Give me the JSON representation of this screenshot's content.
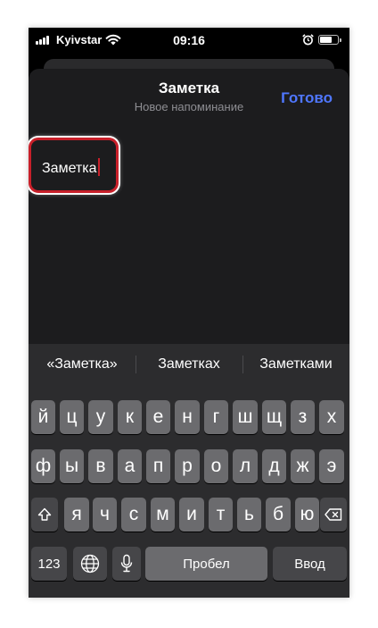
{
  "status": {
    "carrier": "Kyivstar",
    "time": "09:16"
  },
  "nav": {
    "title": "Заметка",
    "subtitle": "Новое напоминание",
    "done": "Готово"
  },
  "note": {
    "value": "Заметка"
  },
  "suggestions": [
    "«Заметка»",
    "Заметках",
    "Заметками"
  ],
  "keyboard": {
    "row1": [
      "й",
      "ц",
      "у",
      "к",
      "е",
      "н",
      "г",
      "ш",
      "щ",
      "з",
      "х"
    ],
    "row2": [
      "ф",
      "ы",
      "в",
      "а",
      "п",
      "р",
      "о",
      "л",
      "д",
      "ж",
      "э"
    ],
    "row3": [
      "я",
      "ч",
      "с",
      "м",
      "и",
      "т",
      "ь",
      "б",
      "ю"
    ],
    "numbers": "123",
    "space": "Пробел",
    "return": "Ввод"
  },
  "icons": [
    "signal-icon",
    "wifi-icon",
    "alarm-icon",
    "battery-icon",
    "shift-icon",
    "backspace-icon",
    "globe-icon",
    "microphone-icon"
  ],
  "colors": {
    "accent": "#4f77ff",
    "highlight": "#c8202a",
    "sheet": "#1c1c1e",
    "keyboard": "#2c2c2e",
    "key": "#6b6b6e"
  }
}
